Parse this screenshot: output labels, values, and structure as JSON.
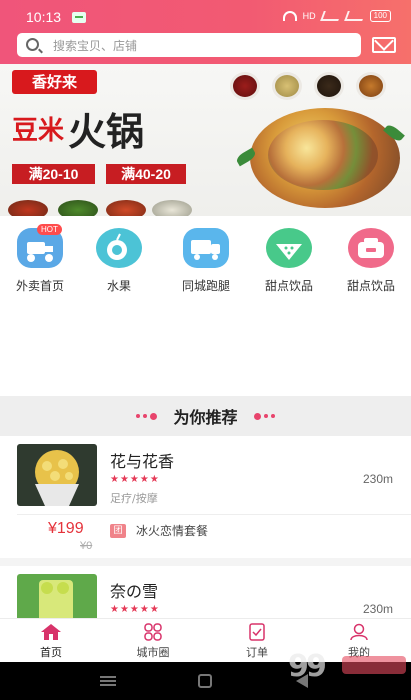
{
  "status_bar": {
    "time": "10:13",
    "network": "HD",
    "battery": "100"
  },
  "search": {
    "placeholder": "搜索宝贝、店铺"
  },
  "banner": {
    "brand": "香好来",
    "title_part1": "豆米",
    "title_part2": "火锅",
    "promo1": "满20-10",
    "promo2": "满40-20"
  },
  "categories": [
    {
      "label": "外卖首页",
      "icon": "delivery-scooter-icon",
      "badge": "HOT",
      "color": "#5aa8e6"
    },
    {
      "label": "水果",
      "icon": "fruit-icon",
      "color": "#4cc3d6"
    },
    {
      "label": "同城跑腿",
      "icon": "truck-icon",
      "color": "#5ab6ec"
    },
    {
      "label": "甜点饮品",
      "icon": "watermelon-icon",
      "color": "#48c98a"
    },
    {
      "label": "甜点饮品",
      "icon": "cooker-icon",
      "color": "#f06a8a"
    }
  ],
  "section": {
    "title": "为你推荐"
  },
  "stores": [
    {
      "name": "花与花香",
      "stars": "★★★★★",
      "rating": 5,
      "distance": "230m",
      "tags": "足疗/按摩",
      "price": "¥199",
      "old_price": "¥0",
      "deal_badge": "团",
      "deal": "冰火恋情套餐"
    },
    {
      "name": "奈の雪",
      "stars": "★★★★★",
      "rating": 5,
      "distance": "230m"
    }
  ],
  "tabs": [
    {
      "label": "首页",
      "icon": "home-icon",
      "active": true
    },
    {
      "label": "城市圈",
      "icon": "grid-icon",
      "active": false
    },
    {
      "label": "订单",
      "icon": "order-icon",
      "active": false
    },
    {
      "label": "我的",
      "icon": "user-icon",
      "active": false
    }
  ],
  "colors": {
    "primary": "#f0557a",
    "price": "#e5333b",
    "star": "#e53a57"
  }
}
